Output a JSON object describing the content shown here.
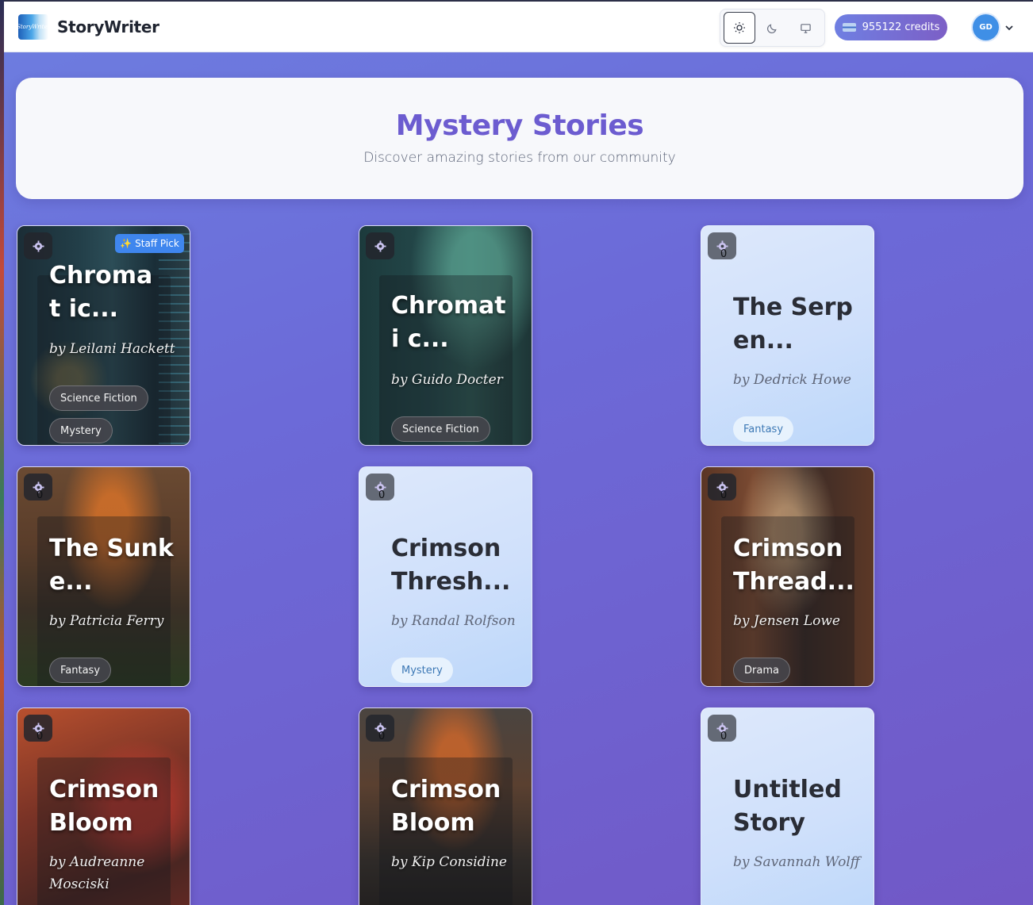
{
  "app": {
    "brand": "StoryWriter",
    "logo_text": "StoryWriter",
    "credits": "955122 credits",
    "avatar_initials": "GD"
  },
  "theme_options": [
    "light",
    "dark",
    "system"
  ],
  "hero": {
    "title": "Mystery Stories",
    "subtitle": "Discover amazing stories from our community"
  },
  "stories": [
    {
      "title": "Chromat ic...",
      "author": "by Leilani Hackett",
      "tags": [
        "Science Fiction",
        "Mystery"
      ],
      "staff_pick": "Staff Pick",
      "count": ""
    },
    {
      "title": "Chromati c...",
      "author": "by Guido Docter",
      "tags": [
        "Science Fiction"
      ],
      "count": ""
    },
    {
      "title": "The Serpen...",
      "author": "by Dedrick Howe",
      "tags": [
        "Fantasy"
      ],
      "count": "0"
    },
    {
      "title": "The Sunke...",
      "author": "by Patricia Ferry",
      "tags": [
        "Fantasy"
      ],
      "count": "0"
    },
    {
      "title": "Crimson Thresh...",
      "author": "by Randal Rolfson",
      "tags": [
        "Mystery"
      ],
      "count": "0"
    },
    {
      "title": "Crimson Thread...",
      "author": "by Jensen Lowe",
      "tags": [
        "Drama"
      ],
      "count": "0"
    },
    {
      "title": "Crimson Bloom",
      "author": "by Audreanne Mosciski",
      "tags": [],
      "count": "0"
    },
    {
      "title": "Crimson Bloom",
      "author": "by Kip Considine",
      "tags": [],
      "count": "0"
    },
    {
      "title": "Untitled Story",
      "author": "by Savannah Wolff",
      "tags": [],
      "count": "0"
    }
  ],
  "colors": {
    "accent": "#6c5cd0",
    "staff_pick": "#3f86ee",
    "avatar": "#3f8fe6"
  }
}
